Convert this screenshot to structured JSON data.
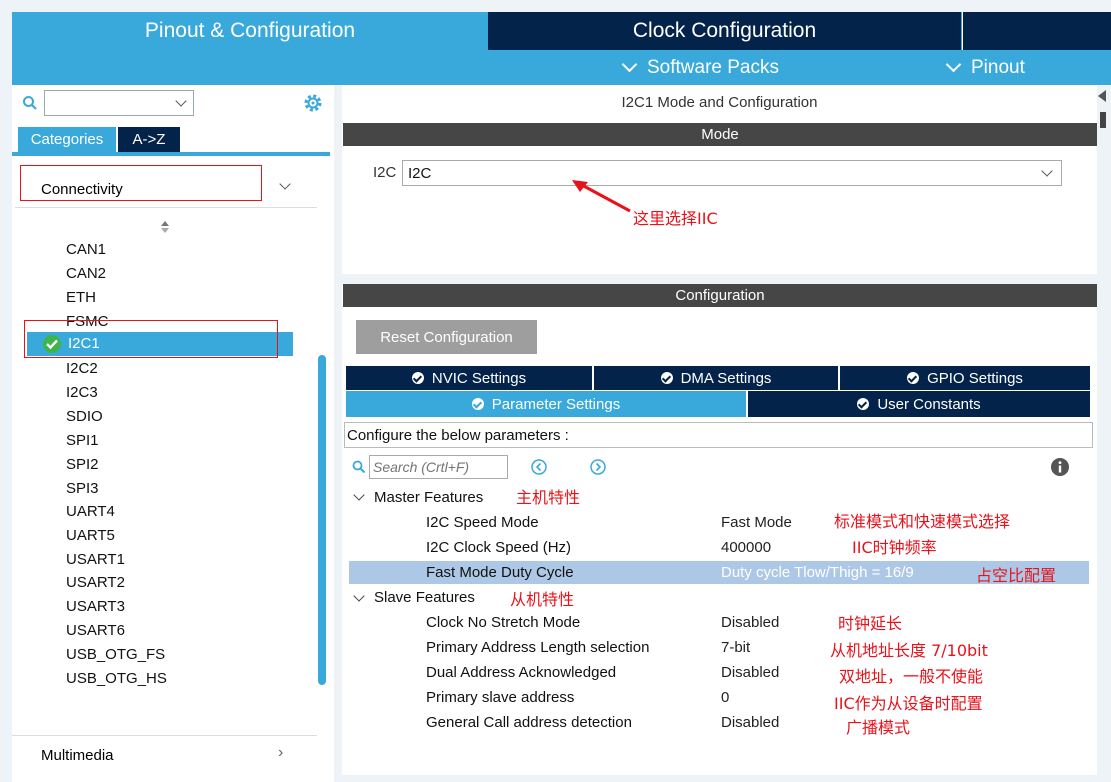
{
  "tabs": {
    "pinout": "Pinout & Configuration",
    "clock": "Clock Configuration"
  },
  "submenu": {
    "software_packs": "Software Packs",
    "pinout": "Pinout"
  },
  "left": {
    "search_value": "",
    "categories_tab": "Categories",
    "az_tab": "A->Z",
    "connectivity_label": "Connectivity",
    "items": [
      "CAN1",
      "CAN2",
      "ETH",
      "FSMC",
      "I2C1",
      "I2C2",
      "I2C3",
      "SDIO",
      "SPI1",
      "SPI2",
      "SPI3",
      "UART4",
      "UART5",
      "USART1",
      "USART2",
      "USART3",
      "USART6",
      "USB_OTG_FS",
      "USB_OTG_HS"
    ],
    "multimedia_label": "Multimedia"
  },
  "right": {
    "title": "I2C1 Mode and Configuration",
    "mode_header": "Mode",
    "i2c_label": "I2C",
    "i2c_value": "I2C",
    "config_header": "Configuration",
    "reset_button": "Reset Configuration",
    "nav_tabs": {
      "nvic": "NVIC Settings",
      "dma": "DMA Settings",
      "gpio": "GPIO Settings",
      "param": "Parameter Settings",
      "user": "User Constants"
    },
    "configure_label": "Configure the below parameters :",
    "search_placeholder": "Search (Crtl+F)",
    "master_group": "Master Features",
    "slave_group": "Slave Features",
    "params": [
      {
        "name": "I2C Speed Mode",
        "value": "Fast Mode"
      },
      {
        "name": "I2C Clock Speed (Hz)",
        "value": "400000"
      },
      {
        "name": "Fast Mode Duty Cycle",
        "value": "Duty cycle Tlow/Thigh = 16/9"
      },
      {
        "name": "Clock No Stretch Mode",
        "value": "Disabled"
      },
      {
        "name": "Primary Address Length selection",
        "value": "7-bit"
      },
      {
        "name": "Dual Address Acknowledged",
        "value": "Disabled"
      },
      {
        "name": "Primary slave address",
        "value": "0"
      },
      {
        "name": "General Call address detection",
        "value": "Disabled"
      }
    ]
  },
  "annotations": {
    "select_iic": "这里选择IIC",
    "master": "主机特性",
    "speed_mode": "标准模式和快速模式选择",
    "clock_freq": "IIC时钟频率",
    "duty": "占空比配置",
    "slave": "从机特性",
    "stretch": "时钟延长",
    "addr_len": "从机地址长度  7/10bit",
    "dual": "双地址，一般不使能",
    "slave_addr": "IIC作为从设备时配置",
    "broadcast": "广播模式"
  },
  "colors": {
    "accent": "#39a9dc",
    "dark": "#03234b",
    "annotation": "#e8121a",
    "selected_row": "#adc8e6"
  }
}
